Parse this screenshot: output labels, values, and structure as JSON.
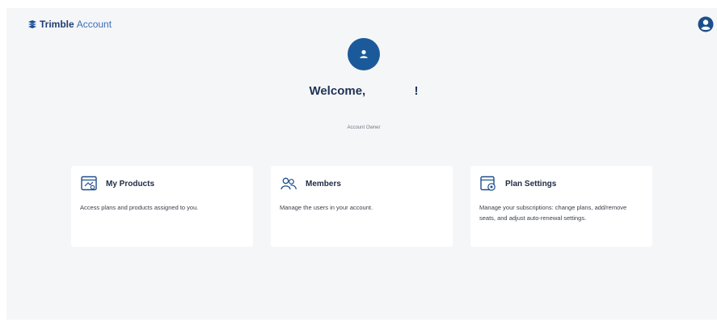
{
  "header": {
    "brand_name": "Trimble",
    "brand_product": "Account",
    "brand_icon": "trimble-logo-icon",
    "user_icon": "user-circle-icon"
  },
  "profile": {
    "avatar_icon": "user-icon",
    "welcome_prefix": "Welcome,",
    "welcome_suffix": "!",
    "role": "Account Owner"
  },
  "cards": [
    {
      "icon": "products-window-icon",
      "title": "My Products",
      "description": "Access plans and products assigned to you."
    },
    {
      "icon": "users-icon",
      "title": "Members",
      "description": "Manage the users in your account."
    },
    {
      "icon": "plan-settings-icon",
      "title": "Plan Settings",
      "description": "Manage your subscriptions: change plans, add/remove seats, and adjust auto-renewal settings."
    }
  ],
  "colors": {
    "brand": "#1f4e8c",
    "avatar_bg": "#1b5a9a",
    "page_bg": "#f5f6f8",
    "card_bg": "#ffffff"
  }
}
